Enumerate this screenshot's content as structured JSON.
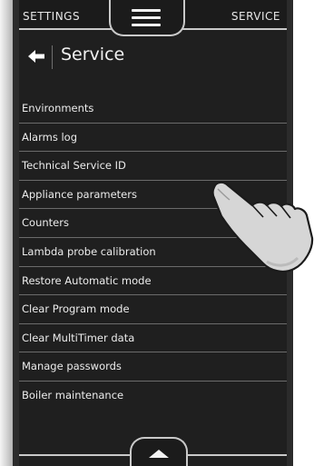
{
  "top_bar": {
    "left_tab": "SETTINGS",
    "right_tab": "SERVICE",
    "menu_icon": "hamburger-icon"
  },
  "header": {
    "back_icon": "back-arrow-icon",
    "title": "Service"
  },
  "menu_items": [
    {
      "label": "Environments"
    },
    {
      "label": "Alarms log"
    },
    {
      "label": "Technical Service ID"
    },
    {
      "label": "Appliance parameters"
    },
    {
      "label": "Counters"
    },
    {
      "label": "Lambda probe calibration"
    },
    {
      "label": "Restore Automatic mode"
    },
    {
      "label": "Clear Program mode"
    },
    {
      "label": "Clear MultiTimer data"
    },
    {
      "label": "Manage passwords"
    },
    {
      "label": "Boiler maintenance"
    }
  ],
  "bottom_bar": {
    "scroll_icon": "chevron-up-icon"
  },
  "colors": {
    "background": "#1f1f1f",
    "text": "#ececec",
    "divider": "#6b6b6b",
    "frame_line": "#c9c9c9"
  }
}
